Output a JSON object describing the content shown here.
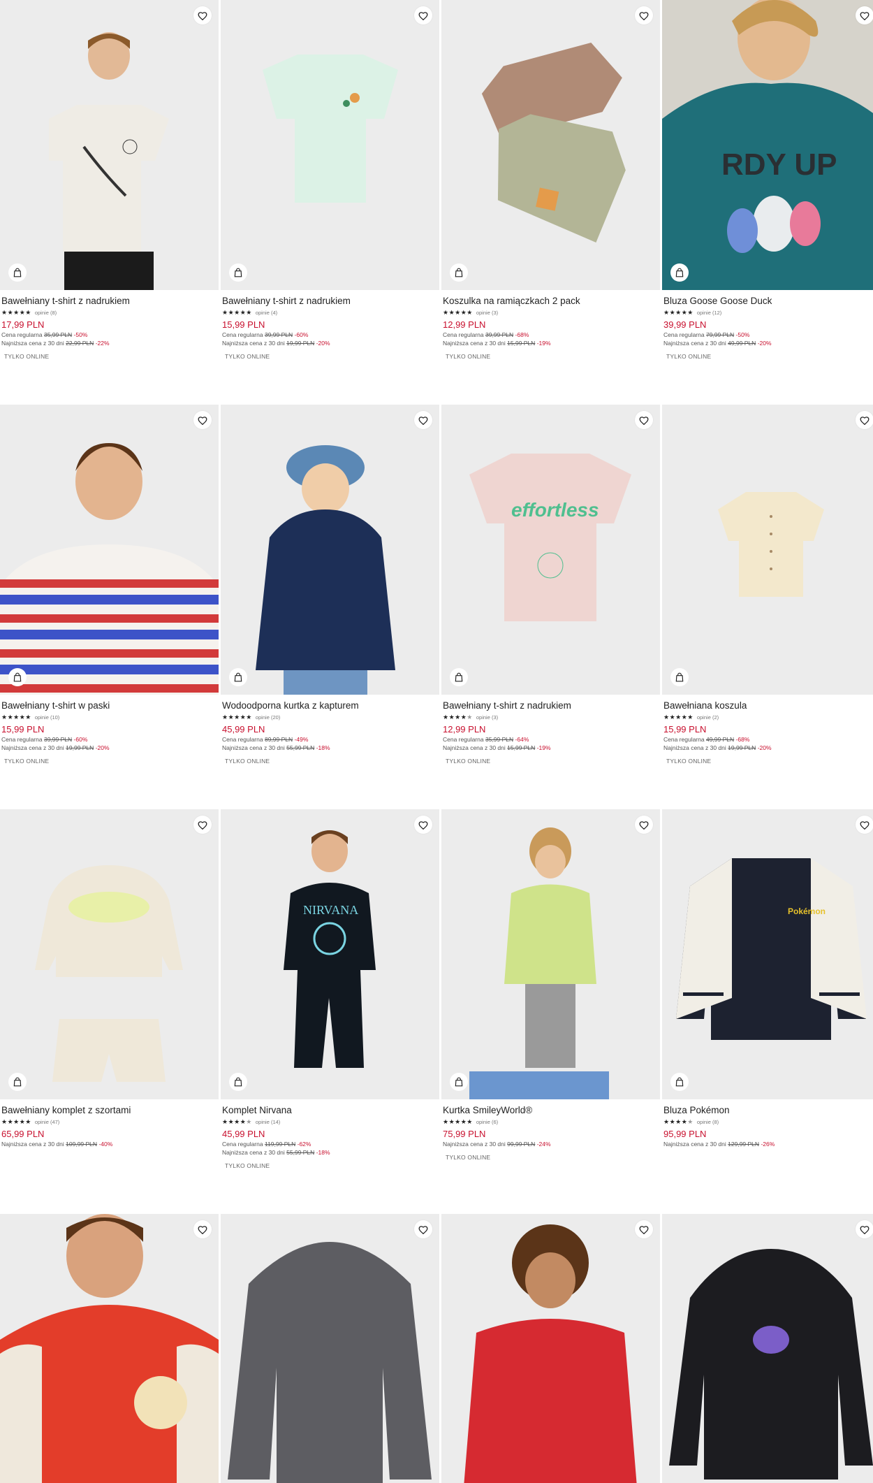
{
  "colors": {
    "price": "#c8102e",
    "text": "#222222",
    "muted": "#555555",
    "image_bg": "#ededed"
  },
  "icons": {
    "favorite": "heart-icon",
    "add_to_cart": "shopping-bag-icon",
    "rating": "star-icon"
  },
  "products": [
    {
      "title": "Bawełniany t-shirt z nadrukiem",
      "stars": "★★★★★",
      "half": "",
      "reviews": "opinie (8)",
      "price": "17,99 PLN",
      "regular_label": "Cena regularna",
      "regular_price": "35,99 PLN",
      "regular_disc": "-50%",
      "lowest_label": "Najniższa cena z 30 dni",
      "lowest_price": "22,99 PLN",
      "lowest_disc": "-22%",
      "badge": "TYLKO ONLINE"
    },
    {
      "title": "Bawełniany t-shirt z nadrukiem",
      "stars": "★★★★★",
      "half": "",
      "reviews": "opinie (4)",
      "price": "15,99 PLN",
      "regular_label": "Cena regularna",
      "regular_price": "39,99 PLN",
      "regular_disc": "-60%",
      "lowest_label": "Najniższa cena z 30 dni",
      "lowest_price": "19,99 PLN",
      "lowest_disc": "-20%",
      "badge": "TYLKO ONLINE"
    },
    {
      "title": "Koszulka na ramiączkach 2 pack",
      "stars": "★★★★★",
      "half": "",
      "reviews": "opinie (3)",
      "price": "12,99 PLN",
      "regular_label": "Cena regularna",
      "regular_price": "39,99 PLN",
      "regular_disc": "-68%",
      "lowest_label": "Najniższa cena z 30 dni",
      "lowest_price": "15,99 PLN",
      "lowest_disc": "-19%",
      "badge": "TYLKO ONLINE"
    },
    {
      "title": "Bluza Goose Goose Duck",
      "stars": "★★★★★",
      "half": "",
      "reviews": "opinie (12)",
      "price": "39,99 PLN",
      "regular_label": "Cena regularna",
      "regular_price": "79,99 PLN",
      "regular_disc": "-50%",
      "lowest_label": "Najniższa cena z 30 dni",
      "lowest_price": "49,99 PLN",
      "lowest_disc": "-20%",
      "badge": "TYLKO ONLINE"
    },
    {
      "title": "Bawełniany t-shirt w paski",
      "stars": "★★★★★",
      "half": "",
      "reviews": "opinie (10)",
      "price": "15,99 PLN",
      "regular_label": "Cena regularna",
      "regular_price": "39,99 PLN",
      "regular_disc": "-60%",
      "lowest_label": "Najniższa cena z 30 dni",
      "lowest_price": "19,99 PLN",
      "lowest_disc": "-20%",
      "badge": "TYLKO ONLINE"
    },
    {
      "title": "Wodoodporna kurtka z kapturem",
      "stars": "★★★★★",
      "half": "",
      "reviews": "opinie (20)",
      "price": "45,99 PLN",
      "regular_label": "Cena regularna",
      "regular_price": "89,99 PLN",
      "regular_disc": "-49%",
      "lowest_label": "Najniższa cena z 30 dni",
      "lowest_price": "55,99 PLN",
      "lowest_disc": "-18%",
      "badge": "TYLKO ONLINE"
    },
    {
      "title": "Bawełniany t-shirt z nadrukiem",
      "stars": "★★★★",
      "half": "★",
      "reviews": "opinie (3)",
      "price": "12,99 PLN",
      "regular_label": "Cena regularna",
      "regular_price": "35,99 PLN",
      "regular_disc": "-64%",
      "lowest_label": "Najniższa cena z 30 dni",
      "lowest_price": "15,99 PLN",
      "lowest_disc": "-19%",
      "badge": "TYLKO ONLINE"
    },
    {
      "title": "Bawełniana koszula",
      "stars": "★★★★★",
      "half": "",
      "reviews": "opinie (2)",
      "price": "15,99 PLN",
      "regular_label": "Cena regularna",
      "regular_price": "49,99 PLN",
      "regular_disc": "-68%",
      "lowest_label": "Najniższa cena z 30 dni",
      "lowest_price": "19,99 PLN",
      "lowest_disc": "-20%",
      "badge": "TYLKO ONLINE"
    },
    {
      "title": "Bawełniany komplet z szortami",
      "stars": "★★★★★",
      "half": "",
      "reviews": "opinie (47)",
      "price": "65,99 PLN",
      "regular_label": "",
      "regular_price": "",
      "regular_disc": "",
      "lowest_label": "Najniższa cena z 30 dni",
      "lowest_price": "109,99 PLN",
      "lowest_disc": "-40%",
      "badge": ""
    },
    {
      "title": "Komplet Nirvana",
      "stars": "★★★★",
      "half": "★",
      "reviews": "opinie (14)",
      "price": "45,99 PLN",
      "regular_label": "Cena regularna",
      "regular_price": "119,99 PLN",
      "regular_disc": "-62%",
      "lowest_label": "Najniższa cena z 30 dni",
      "lowest_price": "55,99 PLN",
      "lowest_disc": "-18%",
      "badge": "TYLKO ONLINE"
    },
    {
      "title": "Kurtka SmileyWorld®",
      "stars": "★★★★★",
      "half": "",
      "reviews": "opinie (6)",
      "price": "75,99 PLN",
      "regular_label": "",
      "regular_price": "",
      "regular_disc": "",
      "lowest_label": "Najniższa cena z 30 dni",
      "lowest_price": "99,99 PLN",
      "lowest_disc": "-24%",
      "badge": "TYLKO ONLINE"
    },
    {
      "title": "Bluza Pokémon",
      "stars": "★★★★",
      "half": "★",
      "reviews": "opinie (8)",
      "price": "95,99 PLN",
      "regular_label": "",
      "regular_price": "",
      "regular_disc": "",
      "lowest_label": "Najniższa cena z 30 dni",
      "lowest_price": "129,99 PLN",
      "lowest_disc": "-26%",
      "badge": ""
    }
  ]
}
